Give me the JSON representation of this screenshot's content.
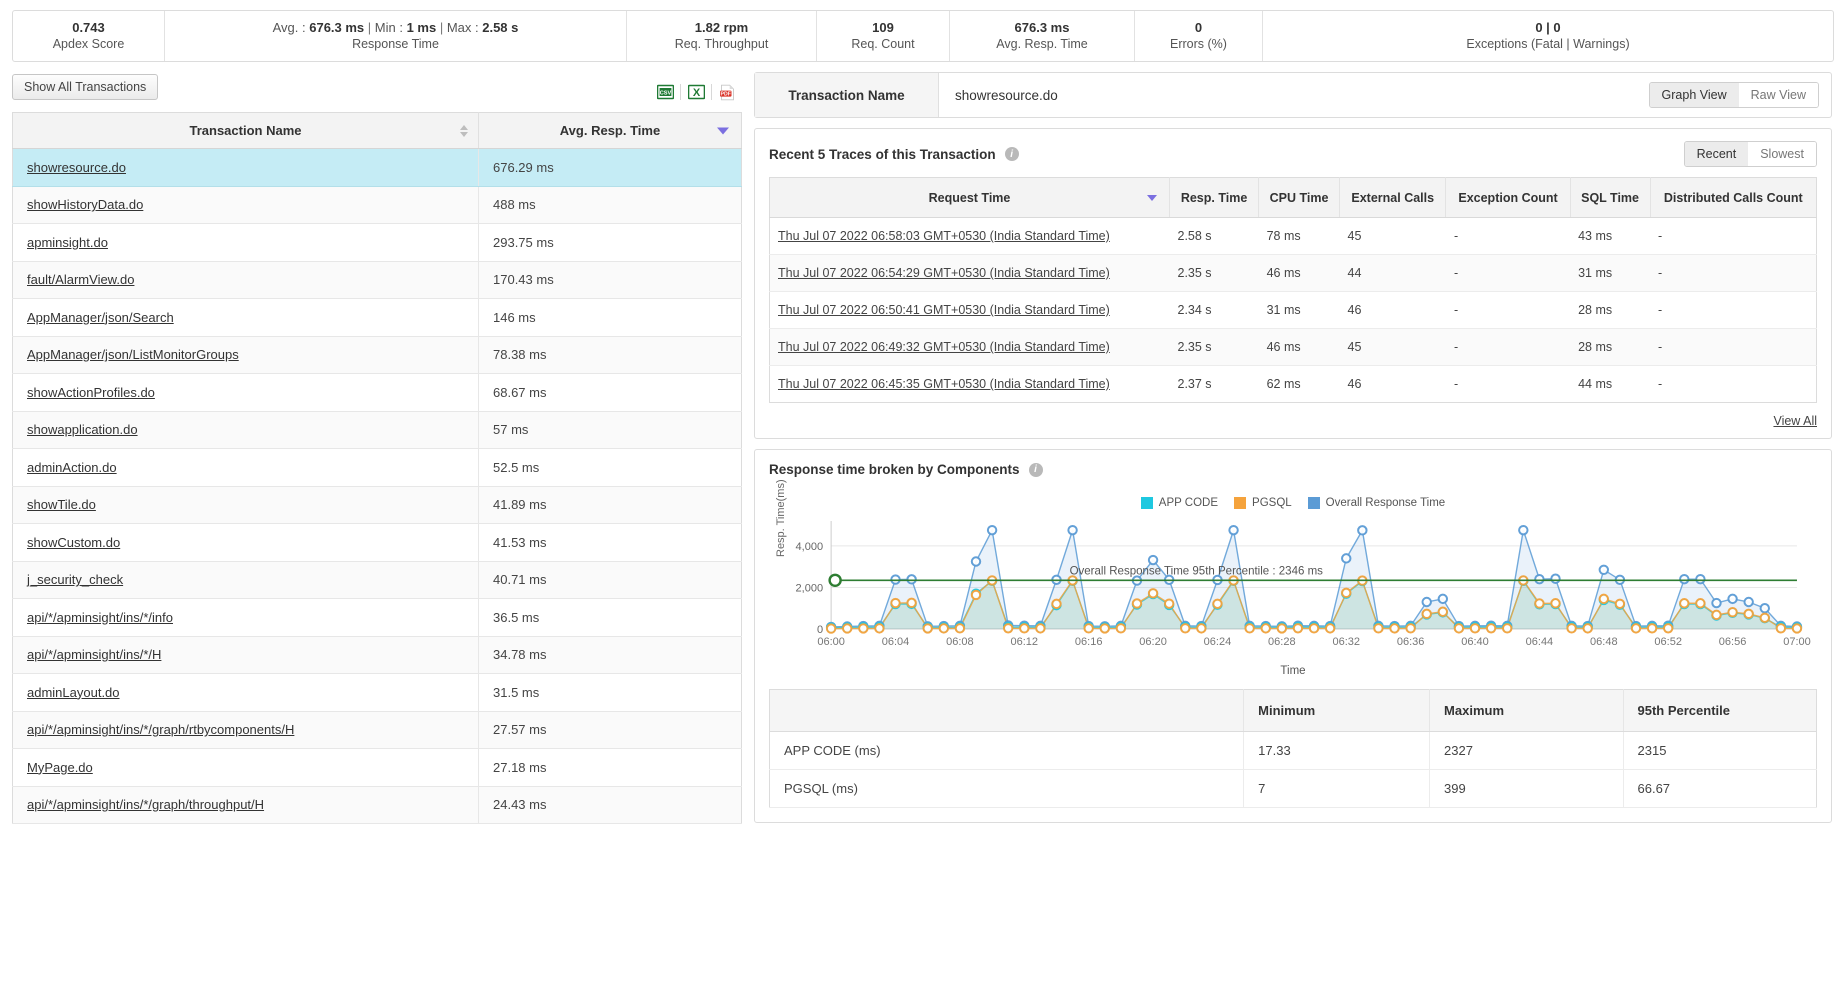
{
  "metrics": [
    {
      "value": "0.743",
      "label": "Apdex Score"
    },
    {
      "value": "",
      "label": "Response Time",
      "rich": [
        {
          "t": "Avg. : ",
          "b": false
        },
        {
          "t": "676.3 ms",
          "b": true
        },
        {
          "t": " | ",
          "b": false
        },
        {
          "t": "Min : ",
          "b": false
        },
        {
          "t": "1 ms",
          "b": true
        },
        {
          "t": " | ",
          "b": false
        },
        {
          "t": "Max : ",
          "b": false
        },
        {
          "t": "2.58 s",
          "b": true
        }
      ]
    },
    {
      "value": "1.82 rpm",
      "label": "Req. Throughput"
    },
    {
      "value": "109",
      "label": "Req. Count"
    },
    {
      "value": "676.3 ms",
      "label": "Avg. Resp. Time"
    },
    {
      "value": "0",
      "label": "Errors (%)"
    },
    {
      "value": "0 | 0",
      "label": "Exceptions (Fatal | Warnings)"
    }
  ],
  "metrics_text": {
    "apdex_value": "0.743",
    "apdex_label": "Apdex Score",
    "resp_label": "Response Time",
    "resp_avg_prefix": "Avg. : ",
    "resp_avg": "676.3 ms",
    "resp_min_prefix": "Min : ",
    "resp_min": "1 ms",
    "resp_max_prefix": "Max : ",
    "resp_max": "2.58 s",
    "sep1": " | ",
    "sep2": " | ",
    "throughput_value": "1.82 rpm",
    "throughput_label": "Req. Throughput",
    "count_value": "109",
    "count_label": "Req. Count",
    "avgresp_value": "676.3 ms",
    "avgresp_label": "Avg. Resp. Time",
    "errors_value": "0",
    "errors_label": "Errors (%)",
    "exceptions_value": "0 | 0",
    "exceptions_label": "Exceptions (Fatal | Warnings)"
  },
  "left": {
    "show_all_button": "Show All Transactions",
    "export": {
      "csv": "csv-export-icon",
      "excel": "excel-export-icon",
      "pdf": "pdf-export-icon",
      "csv_glyph": "CSV"
    },
    "columns": [
      "Transaction Name",
      "Avg. Resp. Time"
    ],
    "rows": [
      {
        "name": "showresource.do",
        "avg": "676.29 ms",
        "selected": true
      },
      {
        "name": "showHistoryData.do",
        "avg": "488 ms",
        "selected": false
      },
      {
        "name": "apminsight.do",
        "avg": "293.75 ms",
        "selected": false
      },
      {
        "name": "fault/AlarmView.do",
        "avg": "170.43 ms",
        "selected": false
      },
      {
        "name": "AppManager/json/Search",
        "avg": "146 ms",
        "selected": false
      },
      {
        "name": "AppManager/json/ListMonitorGroups",
        "avg": "78.38 ms",
        "selected": false
      },
      {
        "name": "showActionProfiles.do",
        "avg": "68.67 ms",
        "selected": false
      },
      {
        "name": "showapplication.do",
        "avg": "57 ms",
        "selected": false
      },
      {
        "name": "adminAction.do",
        "avg": "52.5 ms",
        "selected": false
      },
      {
        "name": "showTile.do",
        "avg": "41.89 ms",
        "selected": false
      },
      {
        "name": "showCustom.do",
        "avg": "41.53 ms",
        "selected": false
      },
      {
        "name": "j_security_check",
        "avg": "40.71 ms",
        "selected": false
      },
      {
        "name": "api/*/apminsight/ins/*/info",
        "avg": "36.5 ms",
        "selected": false
      },
      {
        "name": "api/*/apminsight/ins/*/H",
        "avg": "34.78 ms",
        "selected": false
      },
      {
        "name": "adminLayout.do",
        "avg": "31.5 ms",
        "selected": false
      },
      {
        "name": "api/*/apminsight/ins/*/graph/rtbycomponents/H",
        "avg": "27.57 ms",
        "selected": false
      },
      {
        "name": "MyPage.do",
        "avg": "27.18 ms",
        "selected": false
      },
      {
        "name": "api/*/apminsight/ins/*/graph/throughput/H",
        "avg": "24.43 ms",
        "selected": false
      }
    ]
  },
  "right": {
    "header": {
      "label": "Transaction Name",
      "value": "showresource.do",
      "view_toggle": {
        "graph": "Graph View",
        "raw": "Raw View",
        "active": "Graph View"
      }
    },
    "traces": {
      "title": "Recent 5 Traces of this Transaction",
      "sort_toggle": {
        "recent": "Recent",
        "slowest": "Slowest",
        "active": "Recent"
      },
      "columns": [
        "Request Time",
        "Resp. Time",
        "CPU Time",
        "External Calls",
        "Exception Count",
        "SQL Time",
        "Distributed Calls Count"
      ],
      "rows": [
        {
          "time": "Thu Jul 07 2022 06:58:03 GMT+0530 (India Standard Time)",
          "resp": "2.58 s",
          "cpu": "78 ms",
          "ext": "45",
          "exc": "-",
          "sql": "43 ms",
          "dist": "-"
        },
        {
          "time": "Thu Jul 07 2022 06:54:29 GMT+0530 (India Standard Time)",
          "resp": "2.35 s",
          "cpu": "46 ms",
          "ext": "44",
          "exc": "-",
          "sql": "31 ms",
          "dist": "-"
        },
        {
          "time": "Thu Jul 07 2022 06:50:41 GMT+0530 (India Standard Time)",
          "resp": "2.34 s",
          "cpu": "31 ms",
          "ext": "46",
          "exc": "-",
          "sql": "28 ms",
          "dist": "-"
        },
        {
          "time": "Thu Jul 07 2022 06:49:32 GMT+0530 (India Standard Time)",
          "resp": "2.35 s",
          "cpu": "46 ms",
          "ext": "45",
          "exc": "-",
          "sql": "28 ms",
          "dist": "-"
        },
        {
          "time": "Thu Jul 07 2022 06:45:35 GMT+0530 (India Standard Time)",
          "resp": "2.37 s",
          "cpu": "62 ms",
          "ext": "46",
          "exc": "-",
          "sql": "44 ms",
          "dist": "-"
        }
      ],
      "view_all": "View All"
    },
    "components": {
      "title": "Response time broken by Components",
      "columns": [
        "",
        "Minimum",
        "Maximum",
        "95th Percentile"
      ],
      "rows": [
        {
          "name": "APP CODE (ms)",
          "min": "17.33",
          "max": "2327",
          "p95": "2315"
        },
        {
          "name": "PGSQL (ms)",
          "min": "7",
          "max": "399",
          "p95": "66.67"
        }
      ]
    }
  },
  "chart_data": {
    "type": "line",
    "title": "Response time broken by Components",
    "xlabel": "Time",
    "ylabel": "Resp. Time(ms)",
    "ylim": [
      0,
      5200
    ],
    "yticks": [
      0,
      2000,
      4000
    ],
    "ytick_labels": [
      "0",
      "2,000",
      "4,000"
    ],
    "xticks": [
      "06:00",
      "06:04",
      "06:08",
      "06:12",
      "06:16",
      "06:20",
      "06:24",
      "06:28",
      "06:32",
      "06:36",
      "06:40",
      "06:44",
      "06:48",
      "06:52",
      "06:56",
      "07:00"
    ],
    "grid": true,
    "legend_position": "top-right",
    "legend": [
      {
        "name": "APP CODE",
        "color": "#1ec8e0"
      },
      {
        "name": "PGSQL",
        "color": "#f5a33c"
      },
      {
        "name": "Overall Response Time",
        "color": "#5b9bd5"
      }
    ],
    "threshold": {
      "label": "Overall Response Time 95th Percentile : 2346 ms",
      "value": 2346,
      "color": "#2e7d32"
    },
    "x": [
      "06:00",
      "06:01",
      "06:02",
      "06:03",
      "06:04",
      "06:05",
      "06:06",
      "06:07",
      "06:08",
      "06:09",
      "06:10",
      "06:11",
      "06:12",
      "06:13",
      "06:14",
      "06:15",
      "06:16",
      "06:17",
      "06:18",
      "06:19",
      "06:20",
      "06:21",
      "06:22",
      "06:23",
      "06:24",
      "06:25",
      "06:26",
      "06:27",
      "06:28",
      "06:29",
      "06:30",
      "06:31",
      "06:32",
      "06:33",
      "06:34",
      "06:35",
      "06:36",
      "06:37",
      "06:38",
      "06:39",
      "06:40",
      "06:41",
      "06:42",
      "06:43",
      "06:44",
      "06:45",
      "06:46",
      "06:47",
      "06:48",
      "06:49",
      "06:50",
      "06:51",
      "06:52",
      "06:53",
      "06:54",
      "06:55",
      "06:56",
      "06:57",
      "06:58",
      "06:59",
      "07:00"
    ],
    "series": [
      {
        "name": "Overall Response Time",
        "color": "#5b9bd5",
        "values": [
          100,
          120,
          140,
          150,
          2380,
          2390,
          130,
          140,
          150,
          3250,
          4760,
          170,
          160,
          150,
          2370,
          4760,
          140,
          130,
          150,
          2330,
          3320,
          2370,
          150,
          140,
          2360,
          4760,
          150,
          140,
          130,
          160,
          150,
          140,
          3400,
          4750,
          150,
          140,
          150,
          1300,
          1450,
          140,
          150,
          160,
          150,
          4760,
          2400,
          2420,
          150,
          140,
          2850,
          2370,
          140,
          150,
          160,
          2400,
          2400,
          1250,
          1450,
          1300,
          1000,
          150,
          120
        ]
      },
      {
        "name": "APP CODE",
        "color": "#1ec8e0",
        "values": [
          60,
          70,
          80,
          85,
          1200,
          1210,
          70,
          75,
          80,
          1700,
          2320,
          90,
          85,
          80,
          1150,
          2320,
          80,
          70,
          85,
          1180,
          1680,
          1160,
          85,
          80,
          1170,
          2320,
          85,
          80,
          75,
          90,
          85,
          80,
          1700,
          2310,
          85,
          80,
          85,
          700,
          800,
          80,
          85,
          90,
          85,
          2320,
          1190,
          1200,
          85,
          80,
          1400,
          1170,
          80,
          85,
          90,
          1200,
          1200,
          650,
          780,
          700,
          520,
          85,
          70
        ]
      },
      {
        "name": "PGSQL",
        "color": "#f5a33c",
        "values": [
          20,
          25,
          28,
          30,
          1250,
          1260,
          28,
          30,
          32,
          1640,
          2340,
          35,
          32,
          30,
          1210,
          2340,
          32,
          28,
          33,
          1230,
          1720,
          1220,
          33,
          30,
          1215,
          2340,
          33,
          30,
          28,
          35,
          33,
          30,
          1740,
          2330,
          33,
          30,
          33,
          730,
          830,
          30,
          33,
          35,
          33,
          2340,
          1230,
          1240,
          33,
          30,
          1450,
          1215,
          30,
          33,
          35,
          1240,
          1240,
          680,
          810,
          730,
          540,
          33,
          25
        ]
      }
    ]
  }
}
